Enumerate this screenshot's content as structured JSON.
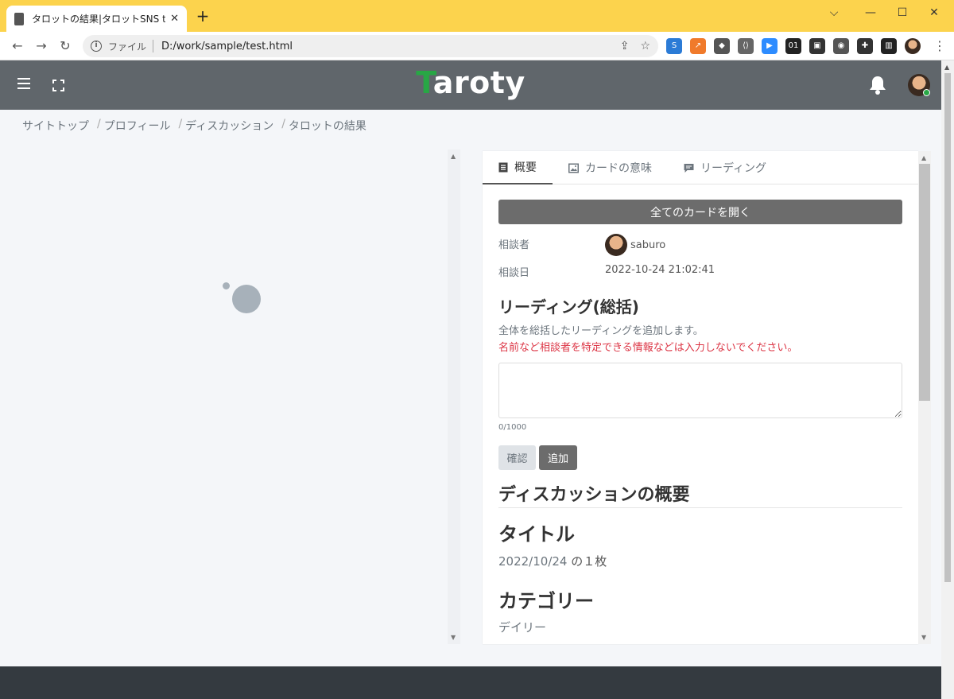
{
  "browser": {
    "tab_title": "タロットの結果|タロットSNS taroty",
    "tab_close": "✕",
    "new_tab": "+",
    "window_controls": {
      "collapse": "⌵",
      "minimize": "—",
      "maximize": "☐",
      "close": "✕"
    },
    "nav": {
      "back": "←",
      "forward": "→",
      "reload": "↻"
    },
    "omnibox": {
      "info": "i",
      "label": "ファイル",
      "url": "D:/work/sample/test.html",
      "share": "⇪",
      "star": "☆"
    },
    "menu": "⋮",
    "extensions": [
      {
        "name": "s-extension-icon",
        "glyph": "S",
        "color": "#2b7bd6"
      },
      {
        "name": "chart-extension-icon",
        "glyph": "↗",
        "color": "#f07a2b"
      },
      {
        "name": "tag-extension-icon",
        "glyph": "◆",
        "color": "#555555"
      },
      {
        "name": "code-extension-icon",
        "glyph": "⟨⟩",
        "color": "#666666"
      },
      {
        "name": "zoom-extension-icon",
        "glyph": "▶",
        "color": "#2d8cff"
      },
      {
        "name": "binary-extension-icon",
        "glyph": "01",
        "color": "#222222"
      },
      {
        "name": "pip-extension-icon",
        "glyph": "▣",
        "color": "#333333"
      },
      {
        "name": "camera-extension-icon",
        "glyph": "◉",
        "color": "#555555"
      },
      {
        "name": "puzzle-extension-icon",
        "glyph": "✚",
        "color": "#333333"
      },
      {
        "name": "sidepanel-extension-icon",
        "glyph": "▥",
        "color": "#222222"
      }
    ]
  },
  "app": {
    "brand_first": "T",
    "brand_rest": "aroty",
    "breadcrumb": [
      {
        "label": "サイトトップ"
      },
      {
        "label": "プロフィール"
      },
      {
        "label": "ディスカッション"
      },
      {
        "label": "タロットの結果"
      }
    ],
    "crumb_sep": "/",
    "scroll_up": "▲",
    "scroll_down": "▼"
  },
  "panel": {
    "tabs": [
      {
        "label": "概要"
      },
      {
        "label": "カードの意味"
      },
      {
        "label": "リーディング"
      }
    ],
    "open_all_label": "全てのカードを開く",
    "consultant_label": "相談者",
    "consultant_name": "saburo",
    "date_label": "相談日",
    "date_value": "2022-10-24 21:02:41",
    "summary_heading": "リーディング(総括)",
    "note": "全体を総括したリーディングを追加します。",
    "warning": "名前など相談者を特定できる情報などは入力しないでください。",
    "counter": "0/1000",
    "confirm_label": "確認",
    "add_label": "追加",
    "discussion_heading": "ディスカッションの概要",
    "title_heading": "タイトル",
    "sub_date": "2022/10/24",
    "sub_count": "の１枚",
    "category_heading": "カテゴリー",
    "category_value": "デイリー"
  },
  "colors": {
    "header": "#60666b",
    "brand_accent": "#28a745",
    "warning": "#dc3545",
    "footer": "#343a40",
    "chrome_titlebar": "#fcd34d"
  }
}
